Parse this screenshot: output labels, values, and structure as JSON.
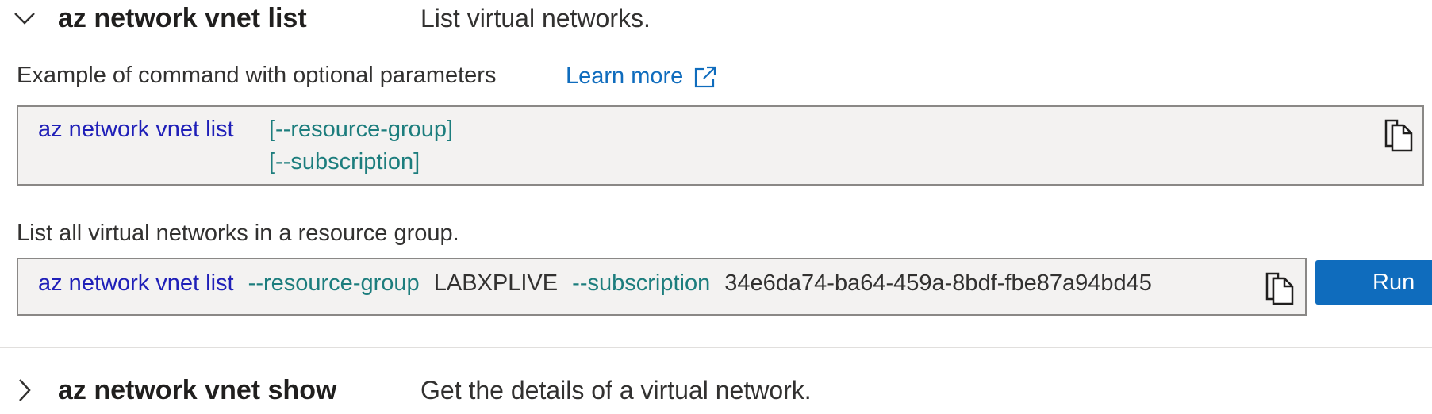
{
  "commands": [
    {
      "name": "az network vnet list",
      "description": "List virtual networks.",
      "expanded": true
    },
    {
      "name": "az network vnet show",
      "description": "Get the details of a virtual network.",
      "expanded": false
    }
  ],
  "optional_example": {
    "label": "Example of command with optional parameters",
    "learn_more": "Learn more",
    "command": "az network vnet list",
    "params": [
      "[--resource-group]",
      "[--subscription]"
    ]
  },
  "example": {
    "label": "List all virtual networks in a resource group.",
    "command": "az network vnet list",
    "param1": "--resource-group",
    "value1": "LABXPLIVE",
    "param2": "--subscription",
    "value2": "34e6da74-ba64-459a-8bdf-fbe87a94bd45",
    "run_label": "Run"
  },
  "colors": {
    "command": "#1f1fb8",
    "parameter": "#1c7d7d",
    "link": "#0f6cbd",
    "run_button": "#0f6cbd",
    "code_background": "#f3f2f1"
  },
  "icons": {
    "expanded": "chevron-down-icon",
    "collapsed": "chevron-right-icon",
    "external": "external-link-icon",
    "copy": "copy-icon"
  }
}
